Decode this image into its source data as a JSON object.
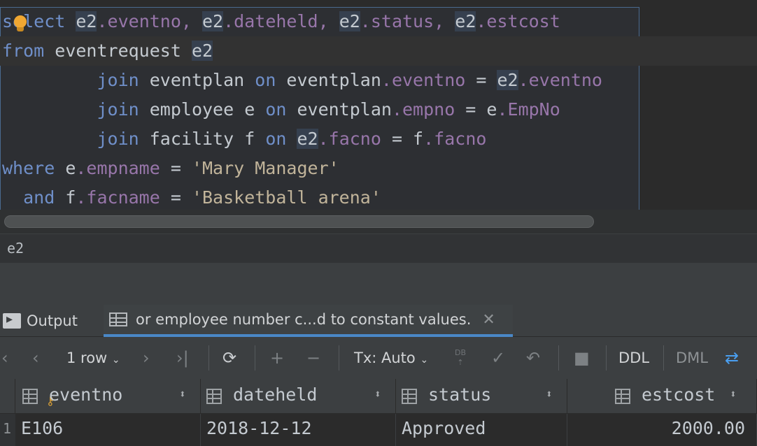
{
  "editor": {
    "lines": {
      "l1": {
        "k1": "select",
        "a1": "e2",
        "c1": ".eventno, ",
        "a2": "e2",
        "c2": ".dateheld, ",
        "a3": "e2",
        "c3": ".status, ",
        "a4": "e2",
        "c4": ".estcost"
      },
      "l2": {
        "k1": "from",
        "p1": " eventrequest ",
        "a1": "e2"
      },
      "l3": {
        "indent": "         ",
        "k1": "join",
        "p1": " eventplan ",
        "k2": "on",
        "p2": " eventplan",
        "c1": ".eventno",
        "p3": " = ",
        "a1": "e2",
        "c2": ".eventno"
      },
      "l4": {
        "indent": "         ",
        "k1": "join",
        "p1": " employee e ",
        "k2": "on",
        "p2": " eventplan",
        "c1": ".empno",
        "p3": " = e",
        "c2": ".EmpNo"
      },
      "l5": {
        "indent": "         ",
        "k1": "join",
        "p1": " facility f ",
        "k2": "on",
        "p2": " ",
        "a1": "e2",
        "c1": ".facno",
        "p3": " = f",
        "c2": ".facno"
      },
      "l6": {
        "k1": "where",
        "p1": " e",
        "c1": ".empname",
        "p2": " = ",
        "s1": "'Mary Manager'"
      },
      "l7": {
        "indent": "  ",
        "k1": "and",
        "p1": " f",
        "c1": ".facname",
        "p2": " = ",
        "s1": "'Basketball arena'"
      }
    },
    "intention_icon": "lightbulb-icon"
  },
  "breadcrumb": {
    "text": "e2"
  },
  "tabs": {
    "output": {
      "label": "Output",
      "icon": "console-icon"
    },
    "result": {
      "label": "or employee number c...d to constant values.",
      "icon": "table-icon"
    }
  },
  "toolbar": {
    "rows_label": "1 row",
    "tx_label": "Tx: Auto",
    "db_label": "DB",
    "ddl_label": "DDL",
    "dml_label": "DML"
  },
  "grid": {
    "columns": [
      "eventno",
      "dateheld",
      "status",
      "estcost"
    ],
    "rows": [
      {
        "rownum": "1",
        "eventno": "E106",
        "dateheld": "2018-12-12",
        "status": "Approved",
        "estcost": "2000.00"
      }
    ]
  },
  "colors": {
    "keyword": "#6f8fc9",
    "column": "#9876aa",
    "string": "#c1b49a",
    "selection_border": "#4a6a8f"
  }
}
